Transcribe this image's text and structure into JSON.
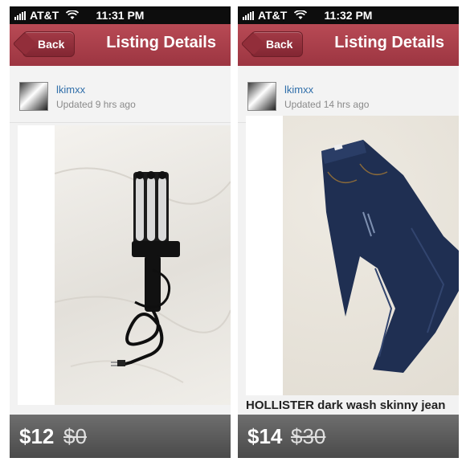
{
  "colors": {
    "nav": "#a8404b",
    "link": "#2f6ea9",
    "price_bar": "#555555"
  },
  "screens": [
    {
      "carrier": "AT&T",
      "time": "11:31 PM",
      "back_label": "Back",
      "title": "Listing Details",
      "username": "lkimxx",
      "updated": "Updated 9 hrs ago",
      "photo_subject": "wave-curling-iron",
      "caption": "",
      "price": "$12",
      "original_price": "$0"
    },
    {
      "carrier": "AT&T",
      "time": "11:32 PM",
      "back_label": "Back",
      "title": "Listing Details",
      "username": "lkimxx",
      "updated": "Updated 14 hrs ago",
      "photo_subject": "skinny-jeans",
      "caption": "HOLLISTER dark wash skinny jean",
      "price": "$14",
      "original_price": "$30"
    }
  ]
}
